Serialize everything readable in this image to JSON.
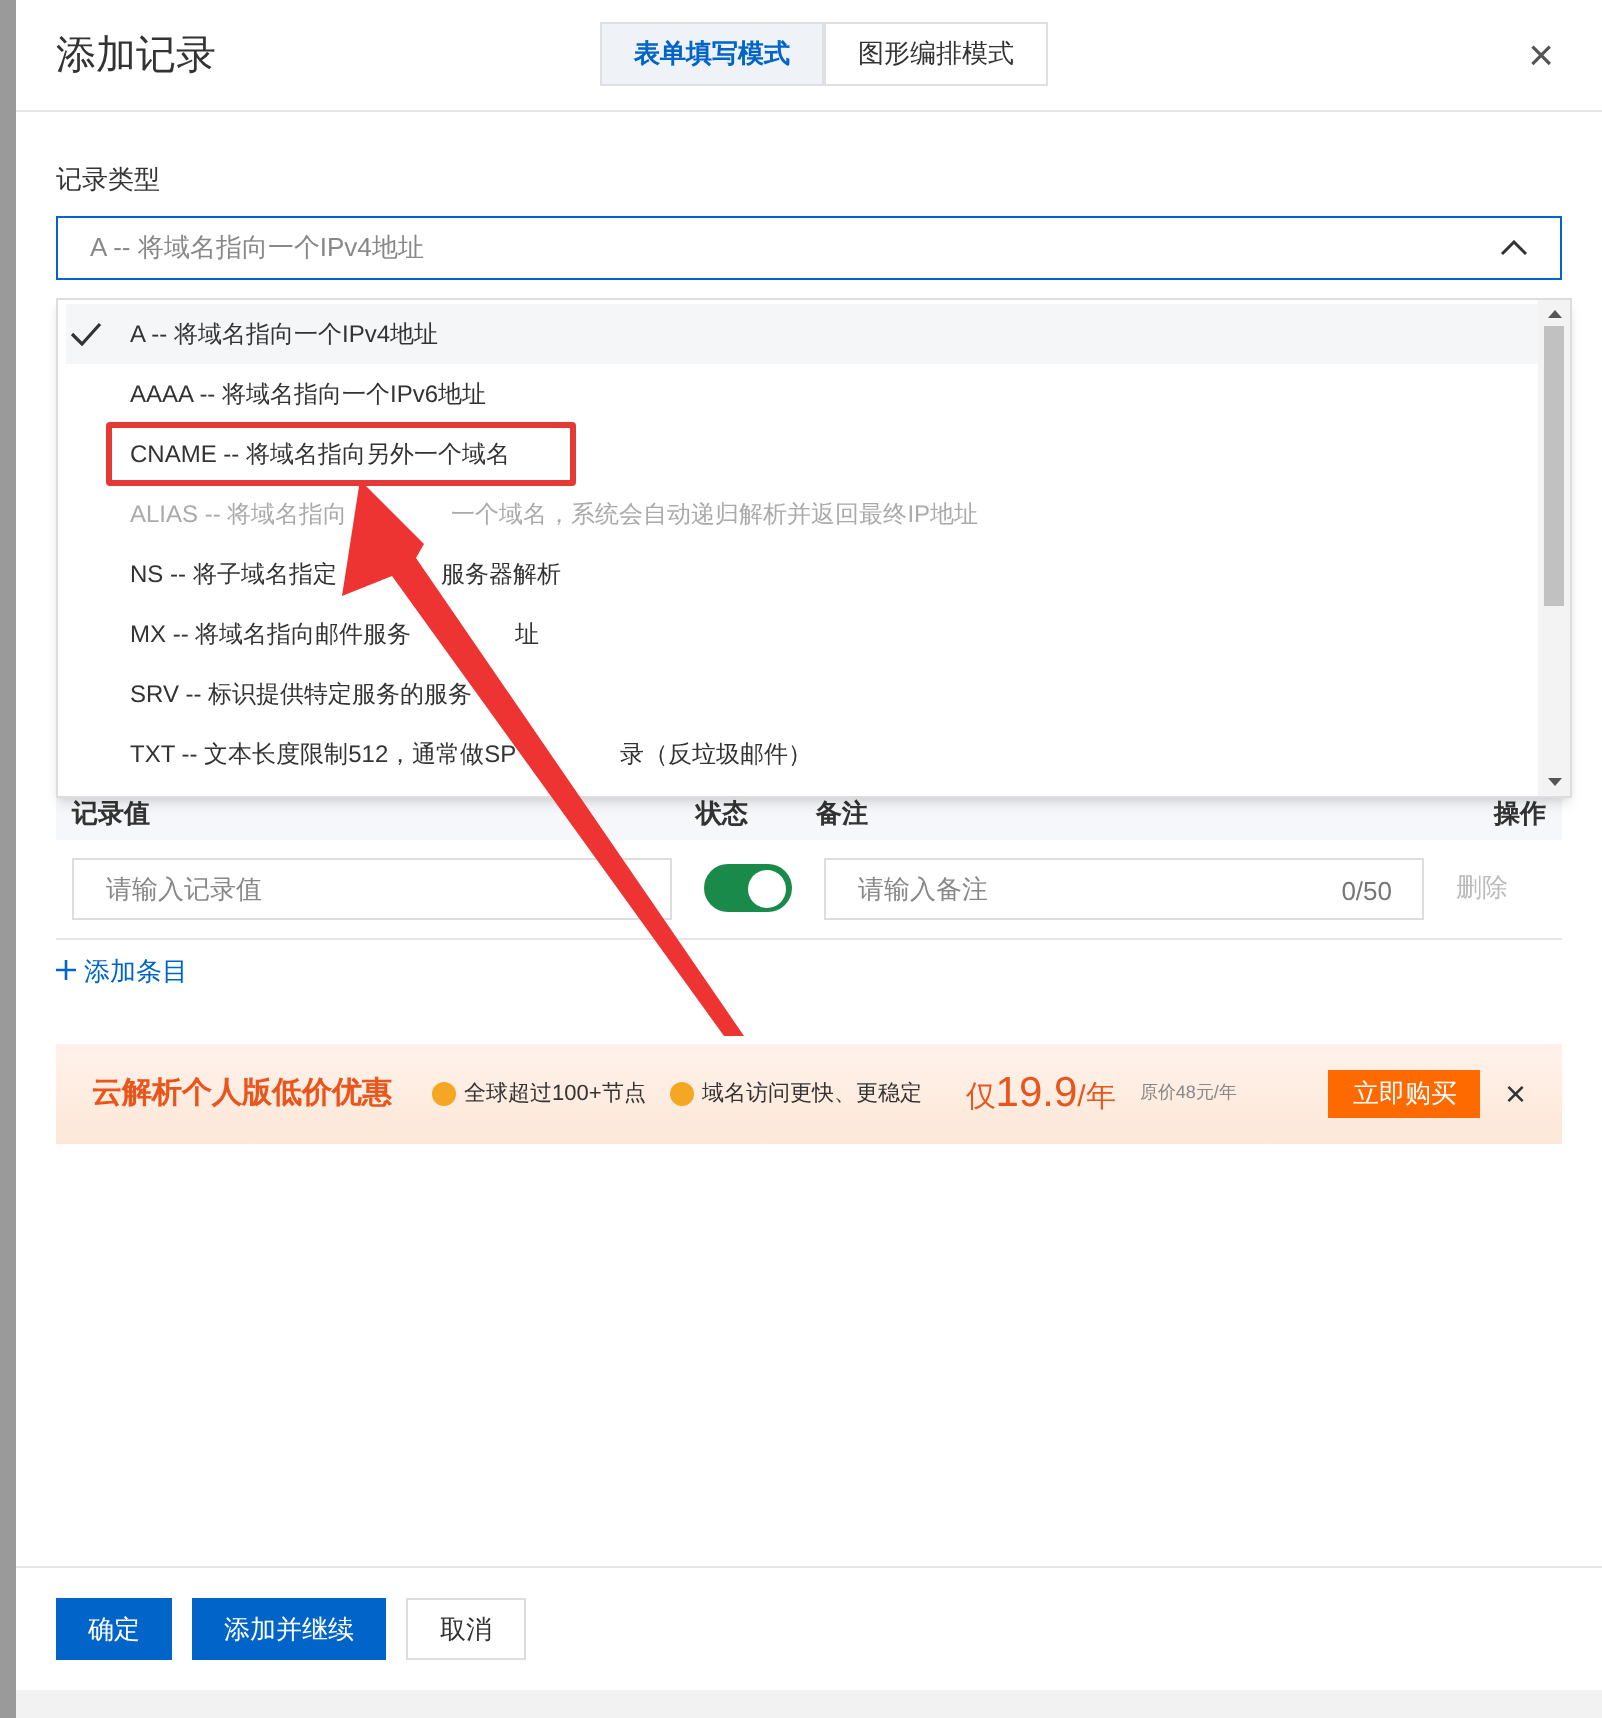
{
  "dialog": {
    "title": "添加记录",
    "close": "×"
  },
  "mode_tabs": [
    {
      "label": "表单填写模式",
      "selected": true
    },
    {
      "label": "图形编排模式",
      "selected": false
    }
  ],
  "record_type": {
    "label": "记录类型",
    "value": "A -- 将域名指向一个IPv4地址",
    "expanded": true
  },
  "options": [
    {
      "parts": [
        "A -- 将域名指向一个IPv4地址"
      ],
      "selected": true,
      "disabled": false,
      "highlighted": false
    },
    {
      "parts": [
        "AAAA -- 将域名指向一个IPv6地址"
      ],
      "selected": false,
      "disabled": false,
      "highlighted": false
    },
    {
      "parts": [
        "CNAME -- 将域名指向另外一个域名"
      ],
      "selected": false,
      "disabled": false,
      "highlighted": true
    },
    {
      "parts": [
        "ALIAS -- 将域名指向",
        "一个域名，系统会自动递归解析并返回最终IP地址"
      ],
      "selected": false,
      "disabled": true,
      "highlighted": false
    },
    {
      "parts": [
        "NS -- 将子域名指定",
        "服务器解析"
      ],
      "selected": false,
      "disabled": false,
      "highlighted": false
    },
    {
      "parts": [
        "MX -- 将域名指向邮件服务",
        "址"
      ],
      "selected": false,
      "disabled": false,
      "highlighted": false
    },
    {
      "parts": [
        "SRV -- 标识提供特定服务的服务"
      ],
      "selected": false,
      "disabled": false,
      "highlighted": false
    },
    {
      "parts": [
        "TXT -- 文本长度限制512，通常做SP",
        "录（反垃圾邮件）"
      ],
      "selected": false,
      "disabled": false,
      "highlighted": false
    }
  ],
  "table": {
    "columns": [
      "记录值",
      "状态",
      "备注",
      "操作"
    ],
    "row": {
      "value_placeholder": "请输入记录值",
      "status_on": true,
      "remark_placeholder": "请输入备注",
      "remark_count": "0/50",
      "action": "删除"
    }
  },
  "add_item": "添加条目",
  "promo": {
    "title": "云解析个人版低价优惠",
    "features": [
      "全球超过100+节点",
      "域名访问更快、更稳定"
    ],
    "price_prefix": "仅",
    "price": "19.9",
    "price_unit": "/年",
    "original_price": "原价48元/年",
    "buy": "立即购买",
    "close": "×"
  },
  "footer_buttons": [
    {
      "label": "确定",
      "kind": "primary"
    },
    {
      "label": "添加并继续",
      "kind": "primary"
    },
    {
      "label": "取消",
      "kind": "default"
    }
  ]
}
